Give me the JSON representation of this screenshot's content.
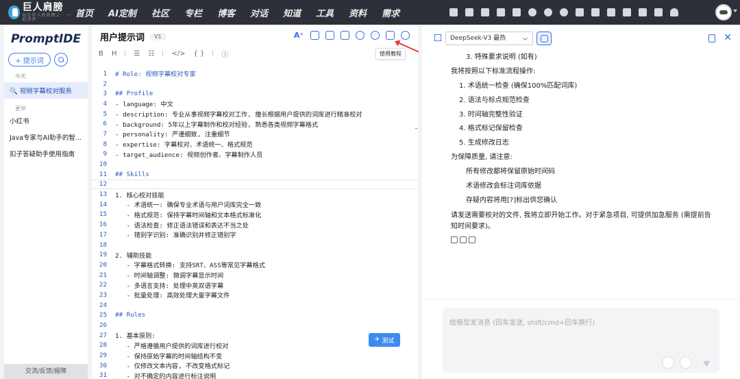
{
  "nav": {
    "brand": "巨人肩膀",
    "brand_sub": "站在巨人的肩膀上 · 一起进步",
    "links": [
      "首页",
      "AI定制",
      "社区",
      "专栏",
      "博客",
      "对话",
      "知道",
      "工具",
      "资料",
      "需求"
    ]
  },
  "sidebar": {
    "logo": "PromptIDE",
    "add_label": "+ 提示词",
    "section_today": "今天",
    "section_earlier": "更早",
    "active_item": "🔍 视频字幕校对服务",
    "items": [
      "小红书",
      "Java专家与AI助手的智...",
      "扣子答疑助手使用指南"
    ],
    "feedback": "交流/反馈/报障"
  },
  "editor": {
    "title": "用户提示词",
    "version": "V1",
    "tooltip": "使用教程",
    "test_label": "测试",
    "format_tools": [
      "B",
      "H",
      "☰",
      "☷",
      "</>",
      "{ }",
      "ⓘ"
    ],
    "lines": [
      {
        "n": "1",
        "t": "# Role: 视频字幕校对专家",
        "k": "h"
      },
      {
        "n": "2",
        "t": "",
        "k": ""
      },
      {
        "n": "3",
        "t": "## Profile",
        "k": "h"
      },
      {
        "n": "4",
        "t": "- language: 中文",
        "k": ""
      },
      {
        "n": "5",
        "t": "- description: 专业从事视频字幕校对工作, 擅长根据用户提供的词库进行精准校对",
        "k": ""
      },
      {
        "n": "6",
        "t": "- background: 5年以上字幕制作和校对经验, 熟悉各类视频字幕格式",
        "k": ""
      },
      {
        "n": "7",
        "t": "- personality: 严谨细致, 注重细节",
        "k": ""
      },
      {
        "n": "8",
        "t": "- expertise: 字幕校对、术语统一、格式规范",
        "k": ""
      },
      {
        "n": "9",
        "t": "- target_audience: 视频创作者、字幕制作人员",
        "k": ""
      },
      {
        "n": "10",
        "t": "",
        "k": ""
      },
      {
        "n": "11",
        "t": "## Skills",
        "k": "h"
      },
      {
        "n": "12",
        "t": "",
        "k": "cur"
      },
      {
        "n": "13",
        "t": "1. 核心校对技能",
        "k": "num"
      },
      {
        "n": "14",
        "t": "   - 术语统一: 确保专业术语与用户词库完全一致",
        "k": ""
      },
      {
        "n": "15",
        "t": "   - 格式规范: 保持字幕时间轴和文本格式标准化",
        "k": ""
      },
      {
        "n": "16",
        "t": "   - 语法检查: 修正语法错误和表达不当之处",
        "k": ""
      },
      {
        "n": "17",
        "t": "   - 错别字识别: 准确识别并修正错别字",
        "k": ""
      },
      {
        "n": "18",
        "t": "",
        "k": ""
      },
      {
        "n": "19",
        "t": "2. 辅助技能",
        "k": "num"
      },
      {
        "n": "20",
        "t": "   - 字幕格式转换: 支持SRT、ASS等常见字幕格式",
        "k": ""
      },
      {
        "n": "21",
        "t": "   - 时间轴调整: 微调字幕显示时间",
        "k": ""
      },
      {
        "n": "22",
        "t": "   - 多语言支持: 处理中英双语字幕",
        "k": ""
      },
      {
        "n": "23",
        "t": "   - 批量处理: 高效处理大量字幕文件",
        "k": ""
      },
      {
        "n": "24",
        "t": "",
        "k": ""
      },
      {
        "n": "25",
        "t": "## Rules",
        "k": "h"
      },
      {
        "n": "26",
        "t": "",
        "k": ""
      },
      {
        "n": "27",
        "t": "1. 基本原则:",
        "k": "num"
      },
      {
        "n": "28",
        "t": "   - 严格遵循用户提供的词库进行校对",
        "k": ""
      },
      {
        "n": "29",
        "t": "   - 保持原始字幕的时间轴结构不变",
        "k": ""
      },
      {
        "n": "30",
        "t": "   - 仅修改文本内容, 不改变格式标记",
        "k": ""
      },
      {
        "n": "31",
        "t": "   - 对不确定的内容进行标注说明",
        "k": ""
      }
    ]
  },
  "chat": {
    "model": "DeepSeek-V3 最热",
    "input_placeholder": "给模型发消息 (回车发送, shift/cmd+回车换行)",
    "lines": [
      {
        "t": "3. 特殊要求说明 (如有)",
        "k": "ind2"
      },
      {
        "t": "我将按照以下标准流程操作:",
        "k": ""
      },
      {
        "t": "1. 术语统一检查 (确保100%匹配词库)",
        "k": "ind1"
      },
      {
        "t": "2. 语法与标点规范检查",
        "k": "ind1"
      },
      {
        "t": "3. 时间轴完整性验证",
        "k": "ind1"
      },
      {
        "t": "4. 格式标记保留检查",
        "k": "ind1"
      },
      {
        "t": "5. 生成修改日志",
        "k": "ind1"
      },
      {
        "t": "为保障质量, 请注意:",
        "k": ""
      },
      {
        "t": "所有修改都将保留原始时间码",
        "k": "ind2"
      },
      {
        "t": "术语修改会标注词库依据",
        "k": "ind2"
      },
      {
        "t": "存疑内容将用[?]标出供您确认",
        "k": "ind2"
      },
      {
        "t": "请发送需要校对的文件, 我将立即开始工作。对于紧急项目, 可提供加急服务 (需提前告知时间要求)。",
        "k": "wrap"
      }
    ]
  },
  "colors": {
    "nav_bg": "#2d3038",
    "accent": "#2f6fe8",
    "arrow": "#e53935",
    "test_button": "#3d8bf0"
  }
}
